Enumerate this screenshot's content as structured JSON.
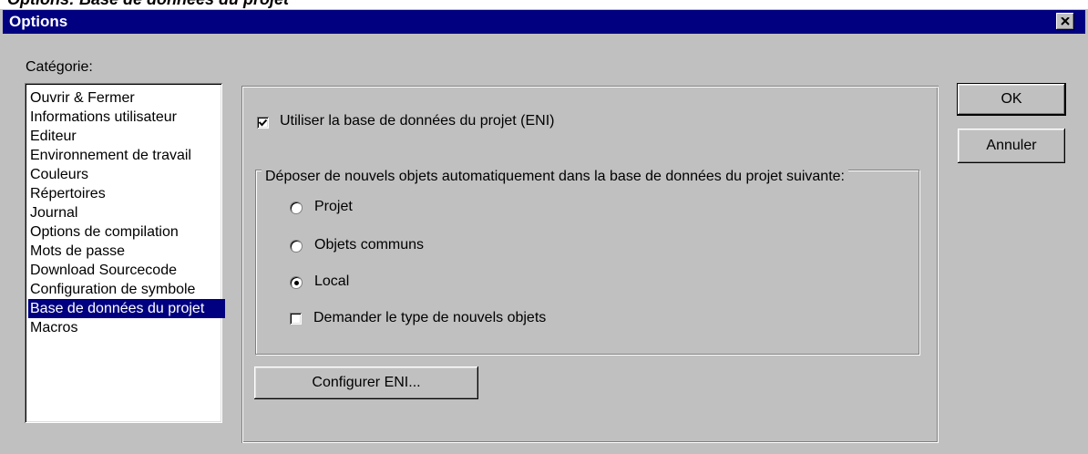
{
  "window": {
    "title": "Options",
    "clipped_heading": "Options: Base de données du projet",
    "close_icon": "close-x-icon"
  },
  "category": {
    "label": "Catégorie:",
    "items": [
      "Ouvrir & Fermer",
      "Informations utilisateur",
      "Editeur",
      "Environnement de travail",
      "Couleurs",
      "Répertoires",
      "Journal",
      "Options de compilation",
      "Mots de passe",
      "Download Sourcecode",
      "Configuration de symbole",
      "Base de données du projet",
      "Macros"
    ],
    "selected_index": 11
  },
  "settings": {
    "use_eni_label": "Utiliser la base de données du projet (ENI)",
    "use_eni_checked": true,
    "group_title": "Déposer de nouvels objets automatiquement dans la base de données du projet suivante:",
    "radio_options": [
      "Projet",
      "Objets communs",
      "Local"
    ],
    "radio_selected": "Local",
    "ask_type_label": "Demander le type de nouvels objets",
    "ask_type_checked": false,
    "configure_button": "Configurer ENI..."
  },
  "buttons": {
    "ok": "OK",
    "cancel": "Annuler"
  },
  "colors": {
    "titlebar": "#000080",
    "face": "#c0c0c0",
    "selection": "#000080"
  }
}
